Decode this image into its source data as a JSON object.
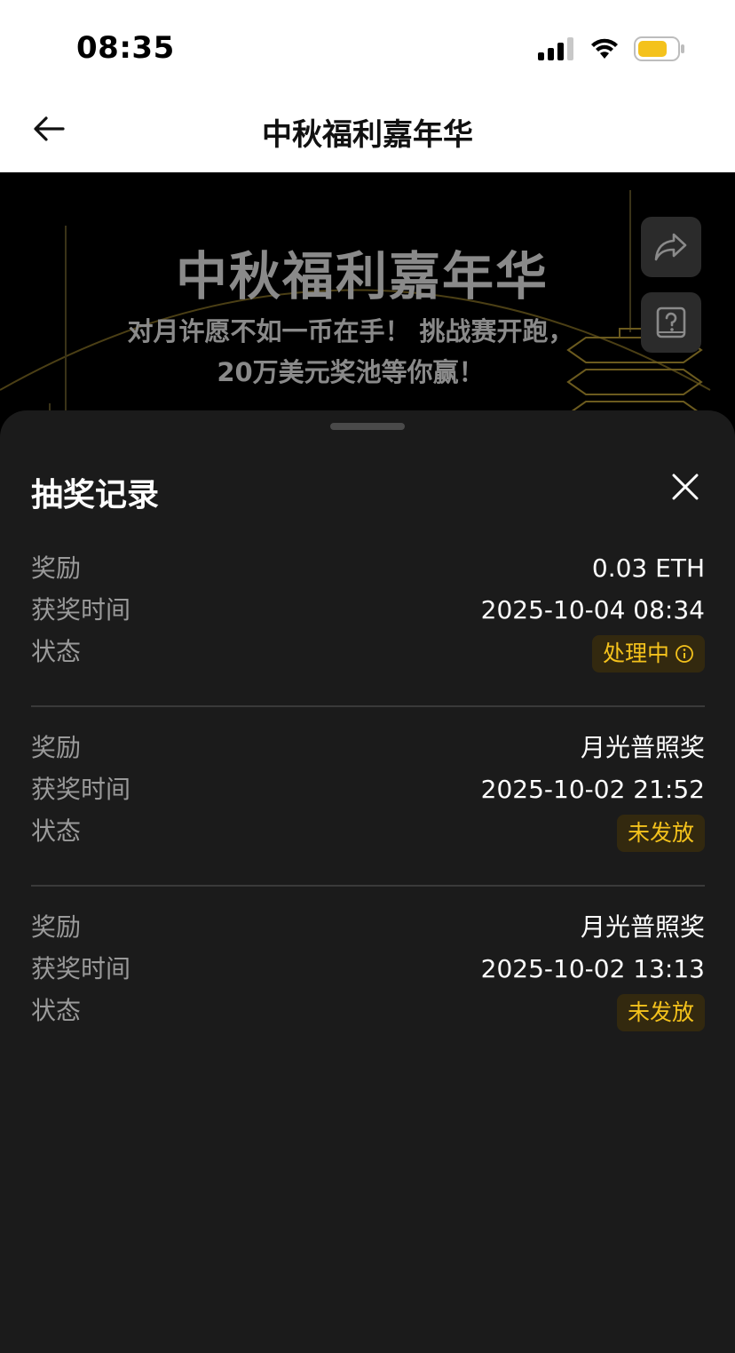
{
  "status_bar": {
    "time": "08:35"
  },
  "nav": {
    "title": "中秋福利嘉年华"
  },
  "banner": {
    "title": "中秋福利嘉年华",
    "subtitle_line1": "对月许愿不如一币在手！ 挑战赛开跑，",
    "subtitle_line2": "20万美元奖池等你赢！"
  },
  "sheet": {
    "title": "抽奖记录",
    "records": [
      {
        "reward_label": "奖励",
        "reward": "0.03 ETH",
        "time_label": "获奖时间",
        "time": "2025-10-04 08:34",
        "status_label": "状态",
        "status": "处理中"
      },
      {
        "reward_label": "奖励",
        "reward": "月光普照奖",
        "time_label": "获奖时间",
        "time": "2025-10-02 21:52",
        "status_label": "状态",
        "status": "未发放"
      },
      {
        "reward_label": "奖励",
        "reward": "月光普照奖",
        "time_label": "获奖时间",
        "time": "2025-10-02 13:13",
        "status_label": "状态",
        "status": "未发放"
      }
    ]
  },
  "colors": {
    "accent": "#f4c21c",
    "badge_bg": "#33290f",
    "sheet_bg": "#1b1b1b"
  },
  "icons": [
    "back-arrow-icon",
    "share-icon",
    "help-icon",
    "close-icon",
    "info-icon"
  ]
}
